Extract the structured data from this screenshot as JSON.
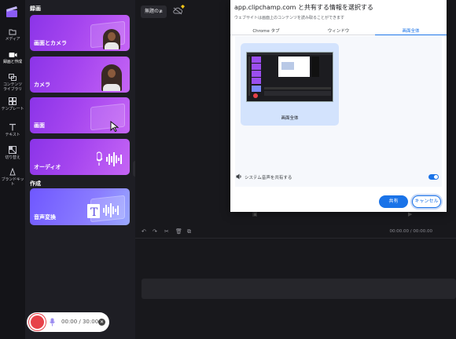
{
  "sidebar": {
    "items": [
      {
        "label": "メディア",
        "icon": "folder-icon"
      },
      {
        "label": "録画と作成",
        "icon": "camera-icon"
      },
      {
        "label": "コンテンツ\nライブラリ",
        "icon": "library-icon"
      },
      {
        "label": "テンプレート",
        "icon": "template-icon"
      },
      {
        "label": "テキスト",
        "icon": "text-icon"
      },
      {
        "label": "切り替え",
        "icon": "transition-icon"
      },
      {
        "label": "ブランドキット",
        "icon": "brand-kit-icon"
      }
    ]
  },
  "panel": {
    "section_record": "録画",
    "section_create": "作成",
    "cards": {
      "screen_camera": "画面とカメラ",
      "camera": "カメラ",
      "screen": "画面",
      "audio": "オーディオ",
      "tts": "音声変換"
    },
    "recorder": {
      "time": "00:00 / 30:00"
    }
  },
  "editor": {
    "project_title": "無題の≱",
    "timeline_time": "00:00.00 / 00:00.00"
  },
  "dialog": {
    "title": "app.clipchamp.com と共有する情報を選択する",
    "subtitle": "ウェブサイトは画面上のコンテンツを読み取ることができます",
    "tabs": [
      "Chrome タブ",
      "ウィンドウ",
      "画面全体"
    ],
    "selected_tab": "画面全体",
    "screen_label": "画面全体",
    "audio_label": "システム音声を共有する",
    "share_button": "共有",
    "cancel_button": "キャンセル"
  },
  "colors": {
    "accent": "#1a73e8",
    "record": "#e7424a",
    "card_purple": "#a545ef"
  }
}
